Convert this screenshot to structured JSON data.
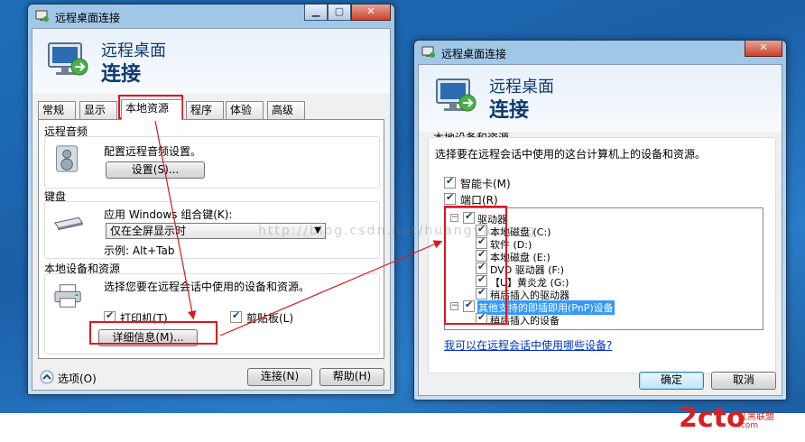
{
  "left_window": {
    "title": "远程桌面连接",
    "header_line1": "远程桌面",
    "header_line2": "连接",
    "tabs": [
      "常规",
      "显示",
      "本地资源",
      "程序",
      "体验",
      "高级"
    ],
    "remote_audio": {
      "title": "远程音频",
      "description": "配置远程音频设置。",
      "button": "设置(S)..."
    },
    "keyboard": {
      "title": "键盘",
      "description": "应用 Windows 组合键(K):",
      "selected": "仅在全屏显示时",
      "example": "示例: Alt+Tab"
    },
    "local_devices": {
      "title": "本地设备和资源",
      "description": "选择您要在远程会话中使用的设备和资源。",
      "printer": "打印机(T)",
      "clipboard": "剪贴板(L)",
      "details_button": "详细信息(M)..."
    },
    "options_label": "选项(O)",
    "connect_button": "连接(N)",
    "help_button": "帮助(H)"
  },
  "right_window": {
    "title": "远程桌面连接",
    "header_line1": "远程桌面",
    "header_line2": "连接",
    "section_title": "本地设备和资源",
    "description": "选择要在远程会话中使用的这台计算机上的设备和资源。",
    "smart_card": "智能卡(M)",
    "ports": "端口(R)",
    "tree": {
      "drives": "驱动器",
      "drive_items": [
        "本地磁盘 (C:)",
        "软件 (D:)",
        "本地磁盘 (E:)",
        "DVD 驱动器 (F:)",
        "【U】黄炎龙 (G:)",
        "稍后插入的驱动器"
      ],
      "pnp": "其他支持的即插即用(PnP)设备",
      "pnp_items": [
        "稍后插入的设备"
      ]
    },
    "help_link": "我可以在远程会话中使用哪些设备?",
    "ok_button": "确定",
    "cancel_button": "取消"
  },
  "watermark": "http://blog.csdn.net/huangyanlong",
  "site_logo": "2cto",
  "site_tagline": "红黑联盟",
  "site_url": ".com",
  "colors": {
    "annotation_red": "#e0161c",
    "selection_blue": "#3399ff",
    "header_blue": "#0d3a72"
  }
}
